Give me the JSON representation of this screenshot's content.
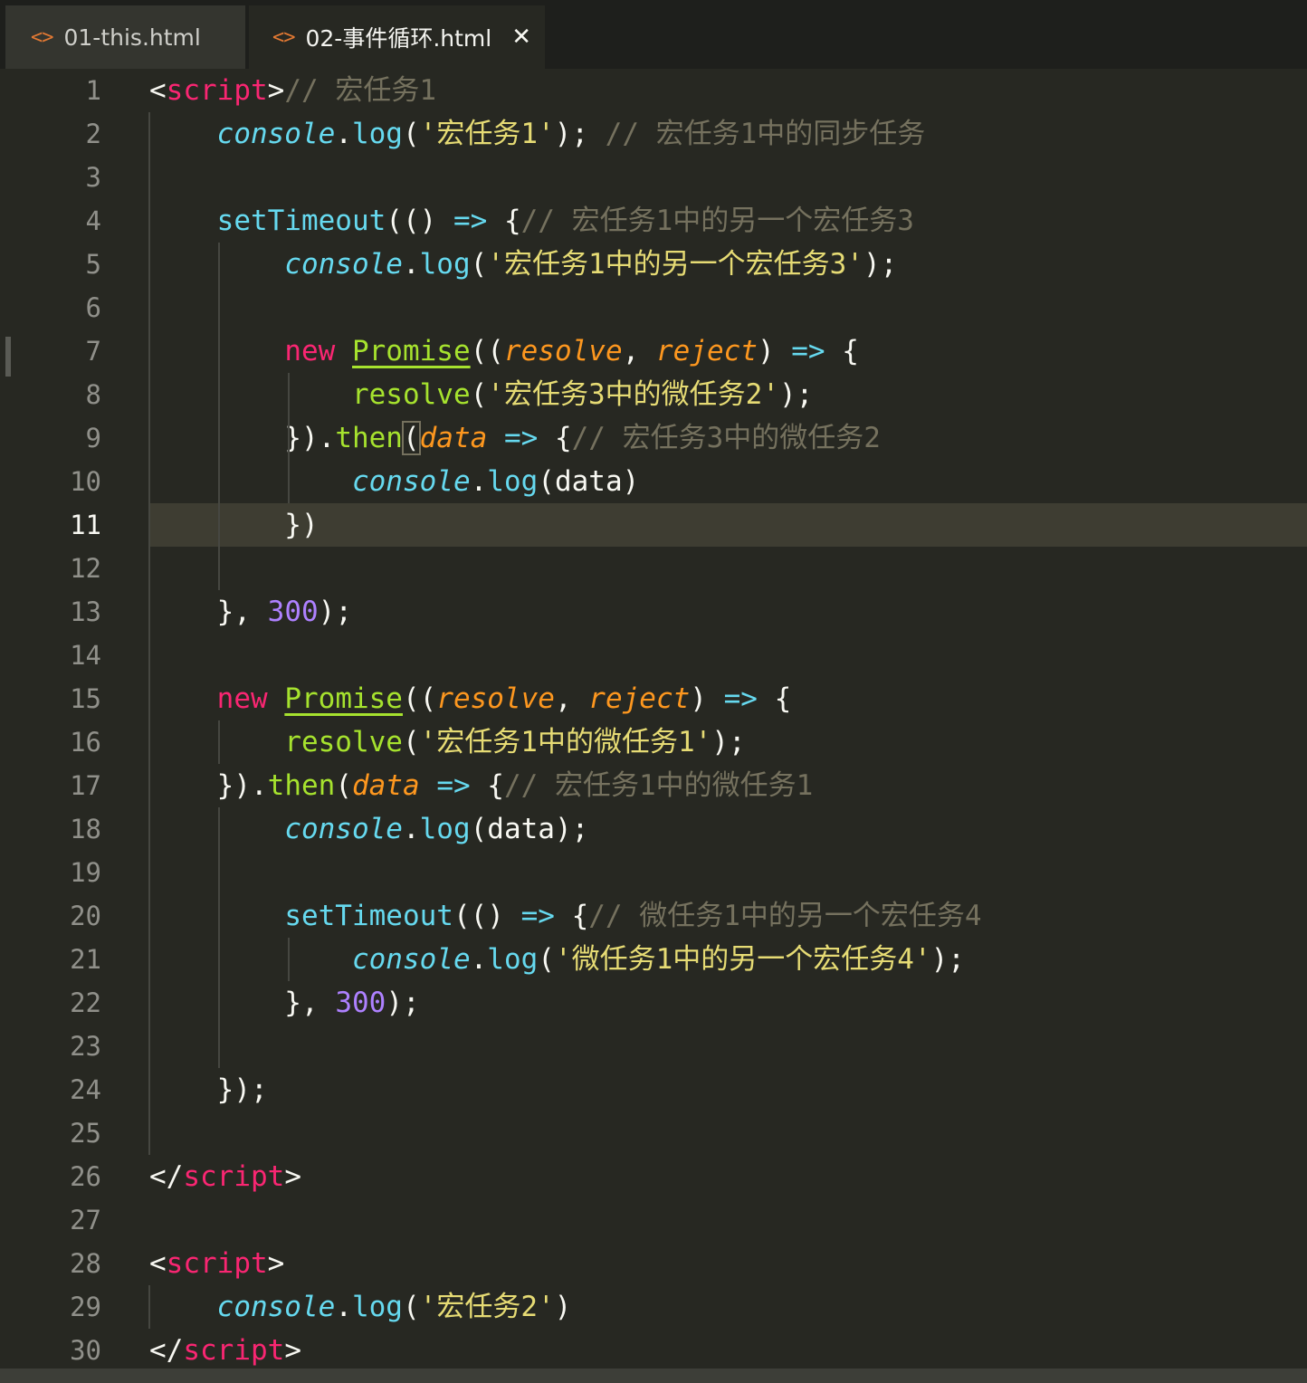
{
  "tabs": [
    {
      "label": "01-this.html",
      "icon": "code-icon",
      "active": false
    },
    {
      "label": "02-事件循环.html",
      "icon": "code-icon",
      "active": true,
      "close": "✕"
    }
  ],
  "editor": {
    "current_line": 11,
    "lines": [
      {
        "n": "1"
      },
      {
        "n": "2"
      },
      {
        "n": "3"
      },
      {
        "n": "4"
      },
      {
        "n": "5"
      },
      {
        "n": "6"
      },
      {
        "n": "7"
      },
      {
        "n": "8"
      },
      {
        "n": "9"
      },
      {
        "n": "10"
      },
      {
        "n": "11"
      },
      {
        "n": "12"
      },
      {
        "n": "13"
      },
      {
        "n": "14"
      },
      {
        "n": "15"
      },
      {
        "n": "16"
      },
      {
        "n": "17"
      },
      {
        "n": "18"
      },
      {
        "n": "19"
      },
      {
        "n": "20"
      },
      {
        "n": "21"
      },
      {
        "n": "22"
      },
      {
        "n": "23"
      },
      {
        "n": "24"
      },
      {
        "n": "25"
      },
      {
        "n": "26"
      },
      {
        "n": "27"
      },
      {
        "n": "28"
      },
      {
        "n": "29"
      },
      {
        "n": "30"
      }
    ],
    "code": [
      [
        [
          "tag",
          "<"
        ],
        [
          "kw",
          "script"
        ],
        [
          "tag",
          ">"
        ],
        [
          "cm",
          "// 宏任务1"
        ]
      ],
      [
        [
          "",
          "    "
        ],
        [
          "ob",
          "console"
        ],
        [
          "",
          "."
        ],
        [
          "fn",
          "log"
        ],
        [
          "",
          "("
        ],
        [
          "st",
          "'宏任务1'"
        ],
        [
          "",
          "); "
        ],
        [
          "cm",
          "// 宏任务1中的同步任务"
        ]
      ],
      [],
      [
        [
          "",
          "    "
        ],
        [
          "fn",
          "setTimeout"
        ],
        [
          "",
          "(() "
        ],
        [
          "ar",
          "=>"
        ],
        [
          "",
          " {"
        ],
        [
          "cm",
          "// 宏任务1中的另一个宏任务3"
        ]
      ],
      [
        [
          "",
          "        "
        ],
        [
          "ob",
          "console"
        ],
        [
          "",
          "."
        ],
        [
          "fn",
          "log"
        ],
        [
          "",
          "("
        ],
        [
          "st",
          "'宏任务1中的另一个宏任务3'"
        ],
        [
          "",
          ");"
        ]
      ],
      [],
      [
        [
          "",
          "        "
        ],
        [
          "kw",
          "new"
        ],
        [
          "",
          " "
        ],
        [
          "cls",
          "Promise"
        ],
        [
          "",
          "(("
        ],
        [
          "par",
          "resolve"
        ],
        [
          "",
          ", "
        ],
        [
          "par",
          "reject"
        ],
        [
          "",
          ") "
        ],
        [
          "ar",
          "=>"
        ],
        [
          "",
          " {"
        ]
      ],
      [
        [
          "",
          "            "
        ],
        [
          "grn",
          "resolve"
        ],
        [
          "",
          "("
        ],
        [
          "st",
          "'宏任务3中的微任务2'"
        ],
        [
          "",
          ");"
        ]
      ],
      [
        [
          "",
          "        })."
        ],
        [
          "grn",
          "then"
        ],
        [
          "br",
          "("
        ],
        [
          "par",
          "data"
        ],
        [
          "",
          " "
        ],
        [
          "ar",
          "=>"
        ],
        [
          "",
          " {"
        ],
        [
          "cm",
          "// 宏任务3中的微任务2"
        ]
      ],
      [
        [
          "",
          "            "
        ],
        [
          "ob",
          "console"
        ],
        [
          "",
          "."
        ],
        [
          "fn",
          "log"
        ],
        [
          "",
          "(data)"
        ]
      ],
      [
        [
          "",
          "        })"
        ]
      ],
      [],
      [
        [
          "",
          "    }, "
        ],
        [
          "num",
          "300"
        ],
        [
          "",
          ");"
        ]
      ],
      [],
      [
        [
          "",
          "    "
        ],
        [
          "kw",
          "new"
        ],
        [
          "",
          " "
        ],
        [
          "cls",
          "Promise"
        ],
        [
          "",
          "(("
        ],
        [
          "par",
          "resolve"
        ],
        [
          "",
          ", "
        ],
        [
          "par",
          "reject"
        ],
        [
          "",
          ") "
        ],
        [
          "ar",
          "=>"
        ],
        [
          "",
          " {"
        ]
      ],
      [
        [
          "",
          "        "
        ],
        [
          "grn",
          "resolve"
        ],
        [
          "",
          "("
        ],
        [
          "st",
          "'宏任务1中的微任务1'"
        ],
        [
          "",
          ");"
        ]
      ],
      [
        [
          "",
          "    })."
        ],
        [
          "grn",
          "then"
        ],
        [
          "",
          "("
        ],
        [
          "par",
          "data"
        ],
        [
          "",
          " "
        ],
        [
          "ar",
          "=>"
        ],
        [
          "",
          " {"
        ],
        [
          "cm",
          "// 宏任务1中的微任务1"
        ]
      ],
      [
        [
          "",
          "        "
        ],
        [
          "ob",
          "console"
        ],
        [
          "",
          "."
        ],
        [
          "fn",
          "log"
        ],
        [
          "",
          "(data);"
        ]
      ],
      [],
      [
        [
          "",
          "        "
        ],
        [
          "fn",
          "setTimeout"
        ],
        [
          "",
          "(() "
        ],
        [
          "ar",
          "=>"
        ],
        [
          "",
          " {"
        ],
        [
          "cm",
          "// 微任务1中的另一个宏任务4"
        ]
      ],
      [
        [
          "",
          "            "
        ],
        [
          "ob",
          "console"
        ],
        [
          "",
          "."
        ],
        [
          "fn",
          "log"
        ],
        [
          "",
          "("
        ],
        [
          "st",
          "'微任务1中的另一个宏任务4'"
        ],
        [
          "",
          ");"
        ]
      ],
      [
        [
          "",
          "        }, "
        ],
        [
          "num",
          "300"
        ],
        [
          "",
          ");"
        ]
      ],
      [],
      [
        [
          "",
          "    });"
        ]
      ],
      [],
      [
        [
          "tag",
          "</"
        ],
        [
          "kw",
          "script"
        ],
        [
          "tag",
          ">"
        ]
      ],
      [],
      [
        [
          "tag",
          "<"
        ],
        [
          "kw",
          "script"
        ],
        [
          "tag",
          ">"
        ]
      ],
      [
        [
          "",
          "    "
        ],
        [
          "ob",
          "console"
        ],
        [
          "",
          "."
        ],
        [
          "fn",
          "log"
        ],
        [
          "",
          "("
        ],
        [
          "st",
          "'宏任务2'"
        ],
        [
          "",
          ")"
        ]
      ],
      [
        [
          "tag",
          "</"
        ],
        [
          "kw",
          "script"
        ],
        [
          "tag",
          ">"
        ]
      ]
    ]
  },
  "colors": {
    "background": "#272822",
    "tabbar": "#1e1f1c",
    "keyword": "#f92672",
    "string": "#e6db74",
    "function": "#66d9ef",
    "class": "#a6e22e",
    "param": "#fd971f",
    "number": "#ae81ff",
    "comment": "#75715e"
  }
}
